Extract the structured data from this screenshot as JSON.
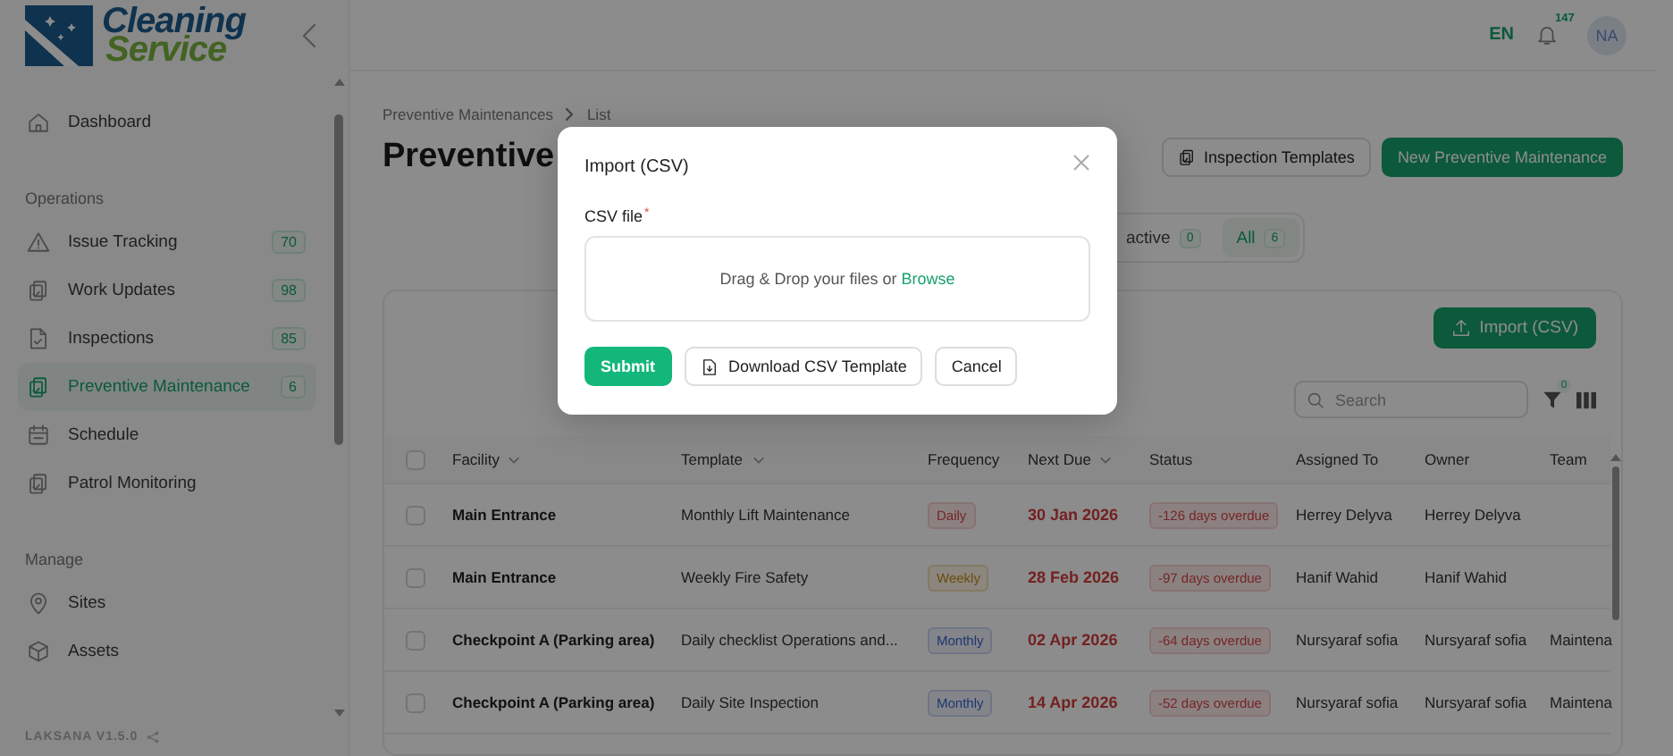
{
  "brand": {
    "line1": "Cleaning",
    "line2": "Service"
  },
  "topbar": {
    "language": "EN",
    "notifications": "147",
    "avatar": "NA"
  },
  "sidebar": {
    "sections": [
      {
        "items": [
          {
            "label": "Dashboard",
            "selected": false
          }
        ]
      },
      {
        "heading": "Operations",
        "items": [
          {
            "label": "Issue Tracking",
            "badge": "70",
            "selected": false
          },
          {
            "label": "Work Updates",
            "badge": "98",
            "selected": false
          },
          {
            "label": "Inspections",
            "badge": "85",
            "selected": false
          },
          {
            "label": "Preventive Maintenance",
            "badge": "6",
            "selected": true
          },
          {
            "label": "Schedule",
            "selected": false
          },
          {
            "label": "Patrol Monitoring",
            "selected": false
          }
        ]
      },
      {
        "heading": "Manage",
        "items": [
          {
            "label": "Sites",
            "selected": false
          },
          {
            "label": "Assets",
            "selected": false
          }
        ]
      }
    ],
    "version": "LAKSANA V1.5.0"
  },
  "breadcrumb": [
    "Preventive Maintenances",
    "List"
  ],
  "page_title": "Preventive",
  "actions": [
    {
      "label": "Inspection Templates",
      "kind": "secondary"
    },
    {
      "label": "New Preventive Maintenance",
      "kind": "primary"
    }
  ],
  "tabs": [
    {
      "label": "active",
      "count": "0",
      "selected": false
    },
    {
      "label": "All",
      "count": "6",
      "selected": true
    }
  ],
  "card": {
    "import_button": "Import (CSV)",
    "search": {
      "placeholder": "Search"
    },
    "filter_count": "0"
  },
  "table": {
    "select_all": {
      "checked": false
    },
    "columns": [
      {
        "label": "Facility",
        "sortable": true
      },
      {
        "label": "Template",
        "sortable": true
      },
      {
        "label": "Frequency",
        "sortable": false
      },
      {
        "label": "Next Due",
        "sortable": true
      },
      {
        "label": "Status",
        "sortable": false
      },
      {
        "label": "Assigned To",
        "sortable": false
      },
      {
        "label": "Owner",
        "sortable": false
      },
      {
        "label": "Team",
        "sortable": false
      }
    ],
    "rows": [
      {
        "checked": false,
        "facility": "Main Entrance",
        "template": "Monthly Lift Maintenance",
        "frequency": {
          "label": "Daily",
          "kind": "daily"
        },
        "next_due": "30 Jan 2026",
        "status": "-126 days overdue",
        "assigned_to": "Herrey Delyva",
        "owner": "Herrey Delyva"
      },
      {
        "checked": false,
        "facility": "Main Entrance",
        "template": "Weekly Fire Safety",
        "frequency": {
          "label": "Weekly",
          "kind": "weekly"
        },
        "next_due": "28 Feb 2026",
        "status": "-97 days overdue",
        "assigned_to": "Hanif Wahid",
        "owner": "Hanif Wahid"
      },
      {
        "checked": false,
        "facility": "Checkpoint A (Parking area)",
        "template": "Daily checklist Operations and...",
        "frequency": {
          "label": "Monthly",
          "kind": "monthly"
        },
        "next_due": "02 Apr 2026",
        "status": "-64 days overdue",
        "assigned_to": "Nursyaraf sofia",
        "owner": "Nursyaraf sofia",
        "team": "Maintena"
      },
      {
        "checked": false,
        "facility": "Checkpoint A (Parking area)",
        "template": "Daily Site Inspection",
        "frequency": {
          "label": "Monthly",
          "kind": "monthly"
        },
        "next_due": "14 Apr 2026",
        "status": "-52 days overdue",
        "assigned_to": "Nursyaraf sofia",
        "owner": "Nursyaraf sofia",
        "team": "Maintena"
      }
    ]
  },
  "dialog": {
    "title": "Import (CSV)",
    "field_label": "CSV file",
    "required_mark": "*",
    "drop_text": "Drag & Drop your files or",
    "browse": "Browse",
    "buttons": [
      {
        "label": "Submit",
        "kind": "primary"
      },
      {
        "label": "Download CSV Template",
        "kind": "download"
      },
      {
        "label": "Cancel",
        "kind": "plain"
      }
    ]
  }
}
